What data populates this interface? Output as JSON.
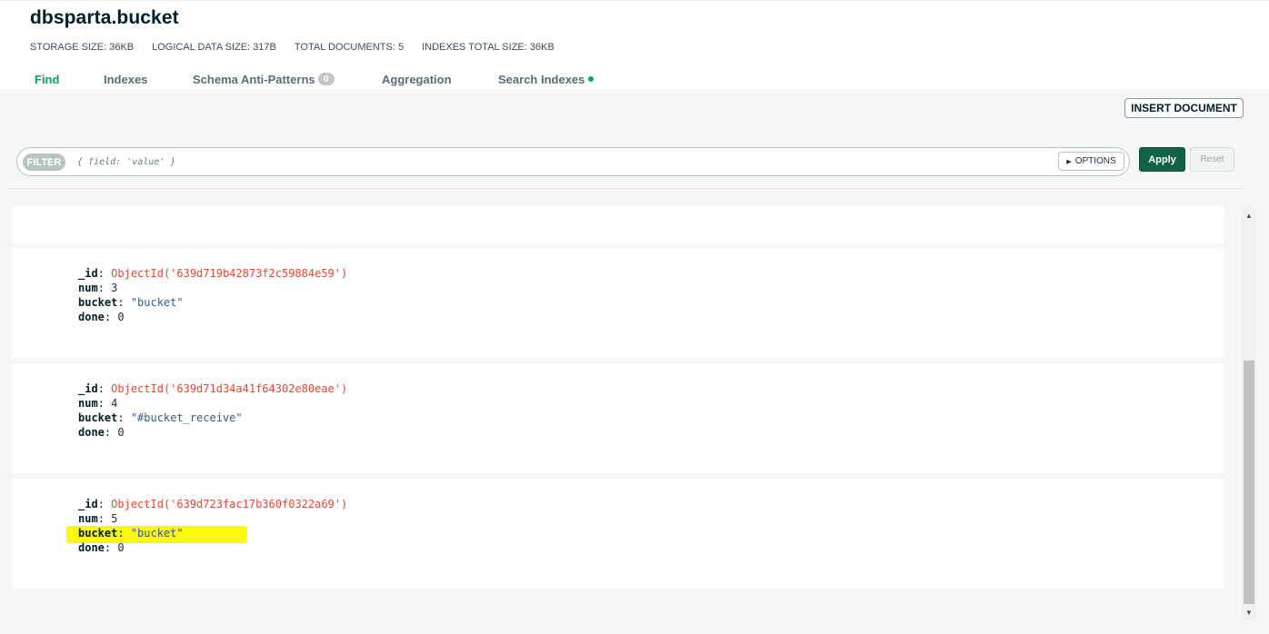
{
  "collection": {
    "title": "dbsparta.bucket"
  },
  "stats": {
    "storage_size": "STORAGE SIZE: 36KB",
    "logical_data_size": "LOGICAL DATA SIZE: 317B",
    "total_documents": "TOTAL DOCUMENTS: 5",
    "indexes_total_size": "INDEXES TOTAL SIZE: 36KB"
  },
  "tabs": [
    {
      "label": "Find",
      "active": true
    },
    {
      "label": "Indexes",
      "active": false
    },
    {
      "label": "Schema Anti-Patterns",
      "badge": "0",
      "active": false
    },
    {
      "label": "Aggregation",
      "active": false
    },
    {
      "label": "Search Indexes",
      "status_dot": true,
      "active": false
    }
  ],
  "toolbar": {
    "insert_label": "INSERT DOCUMENT"
  },
  "filter": {
    "label": "FILTER",
    "value": "",
    "placeholder": "{ field: 'value' }",
    "options_label": "OPTIONS",
    "apply_label": "Apply",
    "reset_label": "Reset"
  },
  "documents": [
    {
      "fields": [
        {
          "key": "_id",
          "value": "ObjectId('639d719b42873f2c59884e59')"
        },
        {
          "key": "num",
          "value": "3"
        },
        {
          "key": "bucket",
          "value": "\"bucket\""
        },
        {
          "key": "done",
          "value": "0"
        }
      ]
    },
    {
      "fields": [
        {
          "key": "_id",
          "value": "ObjectId('639d71d34a41f64302e80eae')"
        },
        {
          "key": "num",
          "value": "4"
        },
        {
          "key": "bucket",
          "value": "\"#bucket_receive\""
        },
        {
          "key": "done",
          "value": "0"
        }
      ]
    },
    {
      "highlighted_field": "bucket",
      "fields": [
        {
          "key": "_id",
          "value": "ObjectId('639d723fac17b360f0322a69')"
        },
        {
          "key": "num",
          "value": "5"
        },
        {
          "key": "bucket",
          "value": "\"bucket\""
        },
        {
          "key": "done",
          "value": "0"
        }
      ]
    }
  ],
  "colors": {
    "accent_green": "#00a35c",
    "apply_button": "#116149",
    "objectid_value": "#e6482f",
    "string_value": "#325e8a",
    "highlight": "#fafa0f"
  }
}
